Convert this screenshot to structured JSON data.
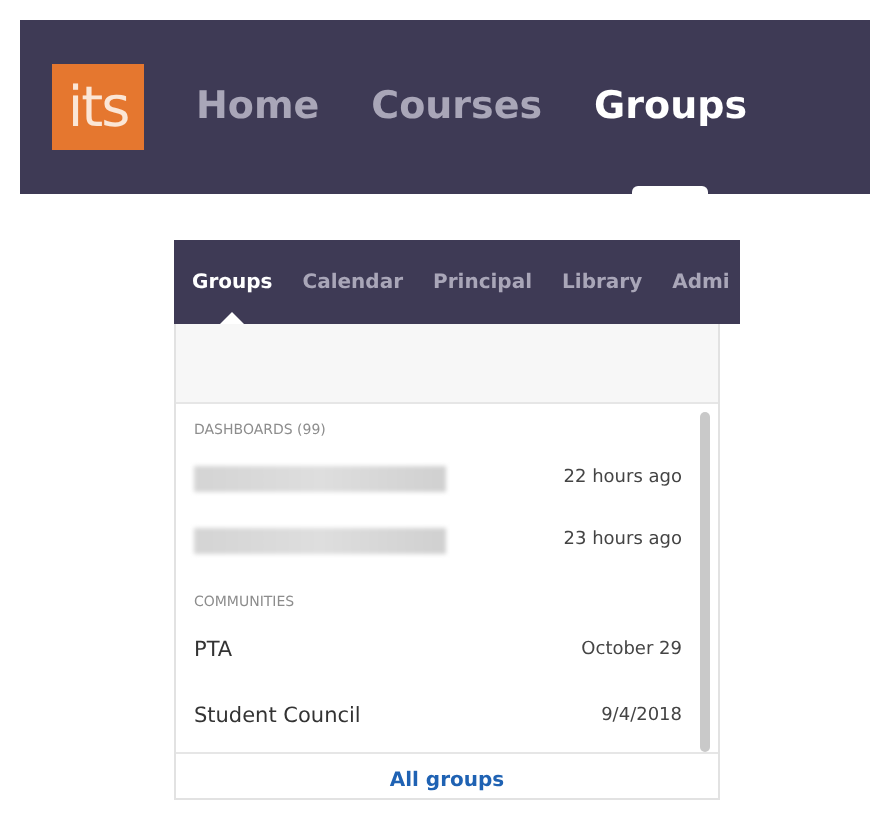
{
  "top_nav": {
    "logo": "its",
    "items": [
      {
        "label": "Home",
        "selected": false
      },
      {
        "label": "Courses",
        "selected": false
      },
      {
        "label": "Groups",
        "selected": true
      }
    ]
  },
  "sub_nav": {
    "items": [
      {
        "label": "Groups",
        "selected": true
      },
      {
        "label": "Calendar",
        "selected": false
      },
      {
        "label": "Principal",
        "selected": false
      },
      {
        "label": "Library",
        "selected": false
      },
      {
        "label": "Admi",
        "selected": false
      }
    ]
  },
  "dropdown": {
    "sections": [
      {
        "heading": "DASHBOARDS (99)",
        "items": [
          {
            "kind": "redacted",
            "time": "22 hours ago"
          },
          {
            "kind": "redacted",
            "time": "23 hours ago"
          }
        ]
      },
      {
        "heading": "COMMUNITIES",
        "items": [
          {
            "kind": "text",
            "name": "PTA",
            "time": "October 29"
          },
          {
            "kind": "text",
            "name": "Student Council",
            "time": "9/4/2018"
          }
        ]
      }
    ],
    "footer_link": "All groups"
  }
}
